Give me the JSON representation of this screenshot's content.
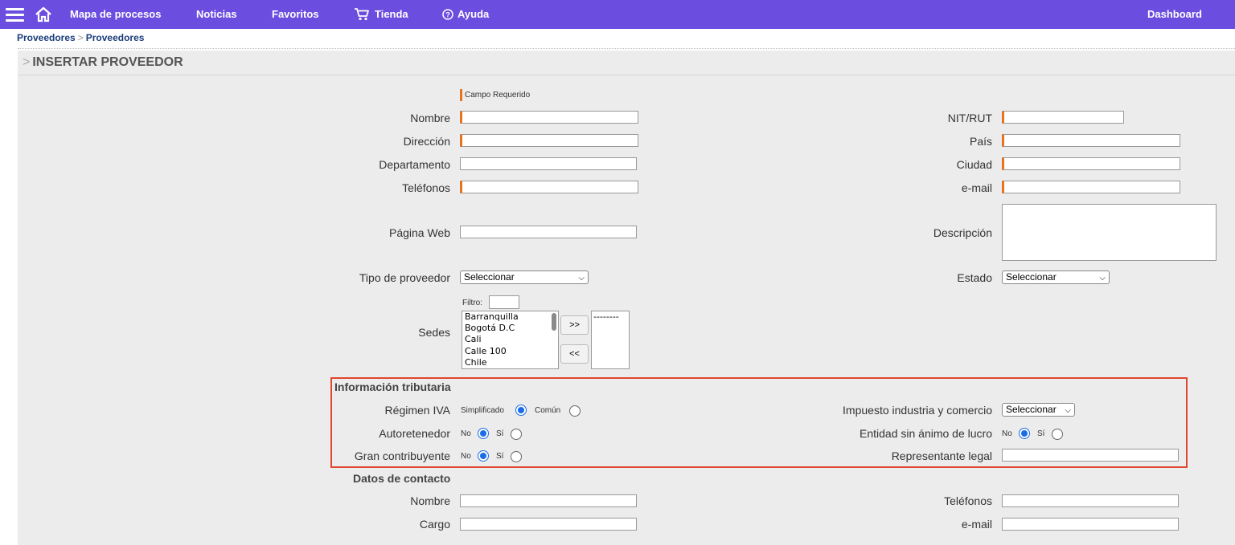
{
  "nav": {
    "menu_icon": "hamburger-menu-icon",
    "home_icon": "home-icon",
    "items": [
      {
        "label": "Mapa de procesos"
      },
      {
        "label": "Noticias"
      },
      {
        "label": "Favoritos"
      },
      {
        "label": "Tienda",
        "icon": "cart-icon"
      },
      {
        "label": "Ayuda",
        "icon": "help-circle-icon"
      }
    ],
    "dashboard": "Dashboard",
    "accent": "#6b4de0"
  },
  "breadcrumb": {
    "first": "Proveedores",
    "separator": ">",
    "second": "Proveedores"
  },
  "page": {
    "arrow": ">",
    "title": "INSERTAR PROVEEDOR"
  },
  "legend": {
    "required": "Campo Requerido",
    "required_color": "#e8731c"
  },
  "fields": {
    "nombre": {
      "label": "Nombre",
      "value": ""
    },
    "direccion": {
      "label": "Dirección",
      "value": ""
    },
    "departamento": {
      "label": "Departamento",
      "value": ""
    },
    "telefonos": {
      "label": "Teléfonos",
      "value": ""
    },
    "pagina_web": {
      "label": "Página Web",
      "value": ""
    },
    "tipo_proveedor": {
      "label": "Tipo de proveedor",
      "selected": "Seleccionar"
    },
    "nit": {
      "label": "NIT/RUT",
      "value": ""
    },
    "pais": {
      "label": "País",
      "value": ""
    },
    "ciudad": {
      "label": "Ciudad",
      "value": ""
    },
    "email": {
      "label": "e-mail",
      "value": ""
    },
    "descripcion": {
      "label": "Descripción",
      "value": ""
    },
    "estado": {
      "label": "Estado",
      "selected": "Seleccionar"
    }
  },
  "sedes": {
    "label": "Sedes",
    "filter_label": "Filtro:",
    "filter_value": "",
    "available": [
      "Barranquilla",
      "Bogotá D.C",
      "Cali",
      "Calle 100",
      "Chile"
    ],
    "selected": [
      "--------"
    ],
    "add_button": ">>",
    "remove_button": "<<"
  },
  "tributaria": {
    "title": "Información tributaria",
    "highlight_color": "#e0472e",
    "regimen_iva": {
      "label": "Régimen IVA",
      "option1": "Simplificado",
      "option2": "Común",
      "selected": "Simplificado"
    },
    "autoretenedor": {
      "label": "Autoretenedor",
      "option1": "No",
      "option2": "Sí",
      "selected": "No"
    },
    "gran_contribuyente": {
      "label": "Gran contribuyente",
      "option1": "No",
      "option2": "Sí",
      "selected": "No"
    },
    "impuesto_ic": {
      "label": "Impuesto industria y comercio",
      "selected": "Seleccionar"
    },
    "entidad_sin_animo": {
      "label": "Entidad sin ánimo de lucro",
      "option1": "No",
      "option2": "Sí",
      "selected": "No"
    },
    "representante_legal": {
      "label": "Representante legal",
      "value": ""
    }
  },
  "contacto": {
    "title": "Datos de contacto",
    "nombre": {
      "label": "Nombre",
      "value": ""
    },
    "cargo": {
      "label": "Cargo",
      "value": ""
    },
    "telefonos": {
      "label": "Teléfonos",
      "value": ""
    },
    "email": {
      "label": "e-mail",
      "value": ""
    }
  }
}
